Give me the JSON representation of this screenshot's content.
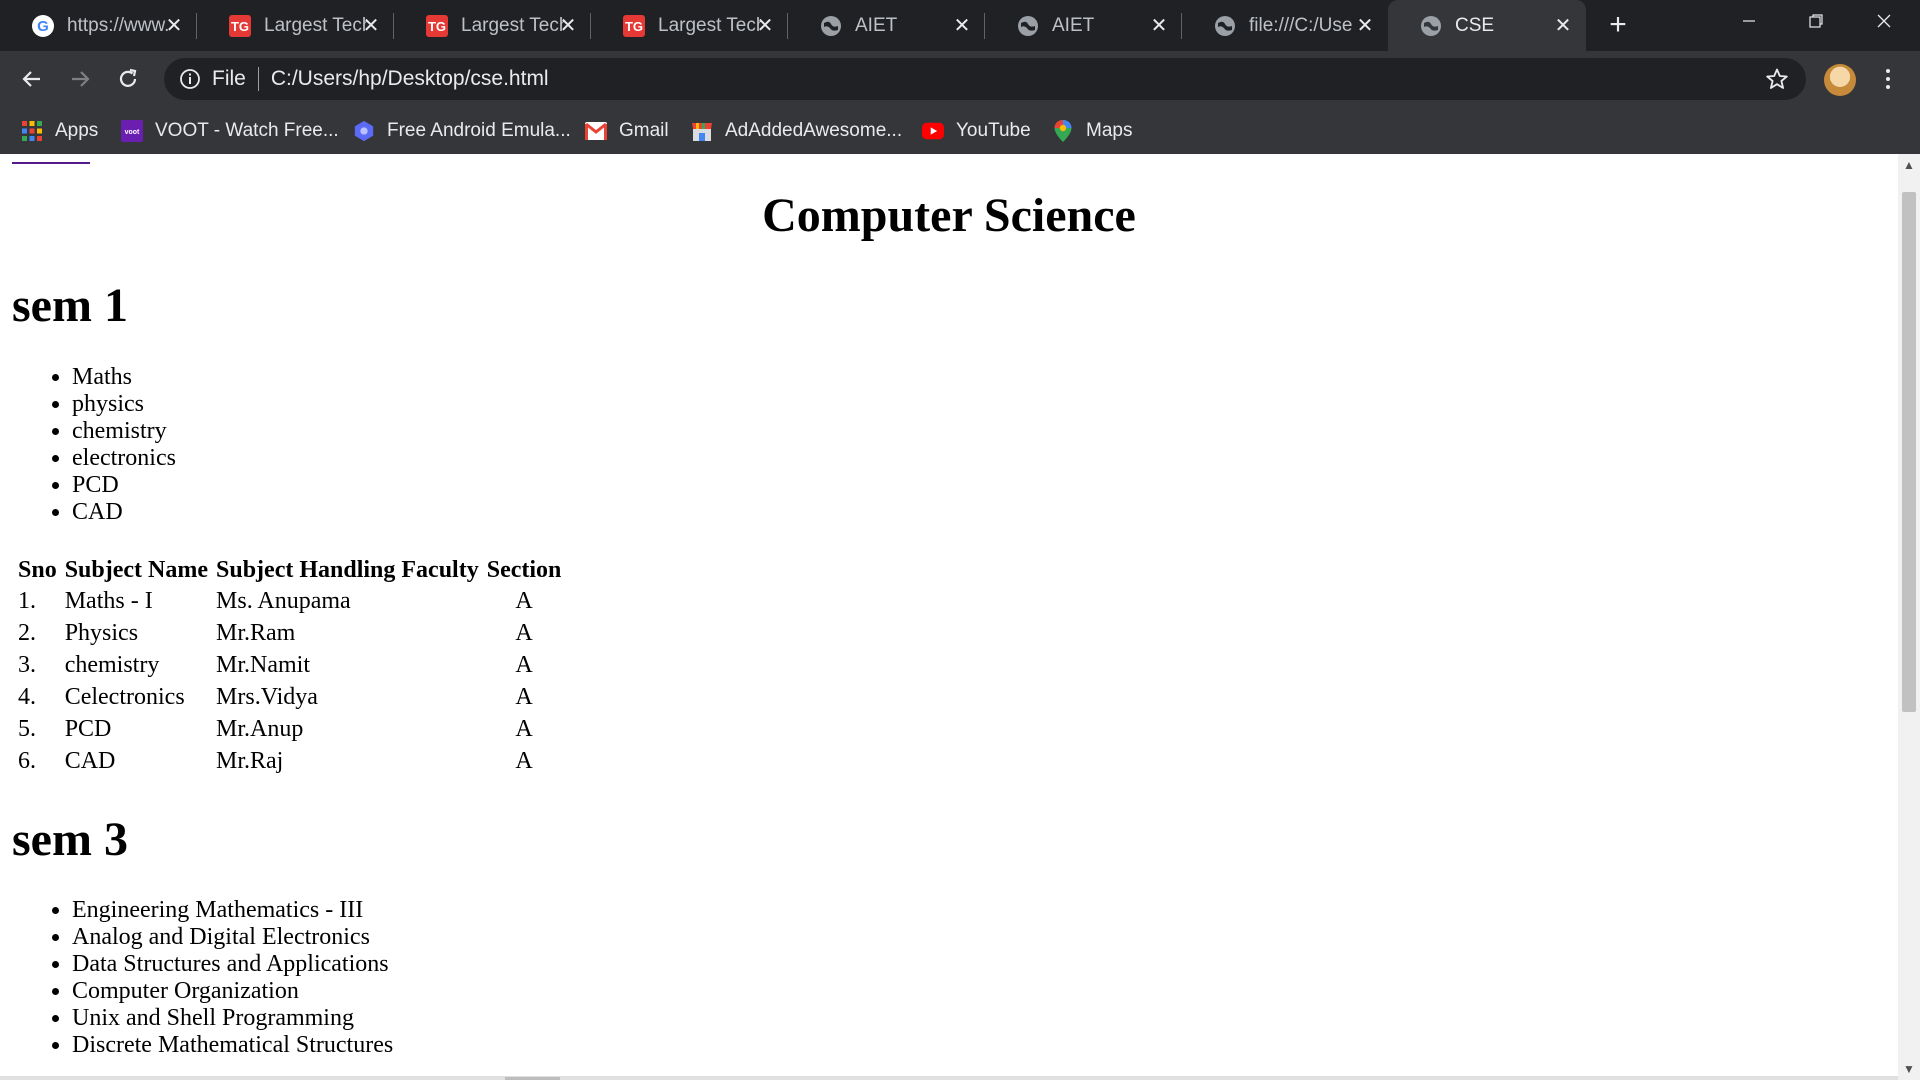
{
  "tabs": [
    {
      "title": "https://www.",
      "icon": "google-icon"
    },
    {
      "title": "Largest Tech",
      "icon": "tg-logo-icon"
    },
    {
      "title": "Largest Tech",
      "icon": "tg-logo-icon"
    },
    {
      "title": "Largest Tech",
      "icon": "tg-logo-icon"
    },
    {
      "title": "AIET",
      "icon": "globe-icon"
    },
    {
      "title": "AIET",
      "icon": "globe-icon"
    },
    {
      "title": "file:///C:/Use",
      "icon": "globe-icon"
    },
    {
      "title": "CSE",
      "icon": "globe-icon",
      "active": true
    }
  ],
  "toolbar": {
    "scheme_label": "File",
    "url": "C:/Users/hp/Desktop/cse.html"
  },
  "bookmarks": [
    {
      "label": "Apps",
      "icon": "apps-grid-icon"
    },
    {
      "label": "VOOT - Watch Free...",
      "icon": "voot-icon"
    },
    {
      "label": "Free Android Emula...",
      "icon": "emulator-icon"
    },
    {
      "label": "Gmail",
      "icon": "gmail-icon"
    },
    {
      "label": "AdAddedAwesome...",
      "icon": "store-icon"
    },
    {
      "label": "YouTube",
      "icon": "youtube-icon"
    },
    {
      "label": "Maps",
      "icon": "maps-icon"
    }
  ],
  "page": {
    "title": "Computer Science",
    "sem1": {
      "heading": "sem 1",
      "subjects": [
        "Maths",
        "physics",
        "chemistry",
        "electronics",
        "PCD",
        "CAD"
      ],
      "table": {
        "headers": [
          "Sno",
          "Subject Name",
          "Subject Handling Faculty",
          "Section"
        ],
        "rows": [
          [
            "1.",
            "Maths - I",
            "Ms. Anupama",
            "A"
          ],
          [
            "2.",
            "Physics",
            "Mr.Ram",
            "A"
          ],
          [
            "3.",
            "chemistry",
            "Mr.Namit",
            "A"
          ],
          [
            "4.",
            "Celectronics",
            "Mrs.Vidya",
            "A"
          ],
          [
            "5.",
            "PCD",
            "Mr.Anup",
            "A"
          ],
          [
            "6.",
            "CAD",
            "Mr.Raj",
            "A"
          ]
        ]
      }
    },
    "sem3": {
      "heading": "sem 3",
      "subjects": [
        "Engineering Mathematics - III",
        "Analog and Digital Electronics",
        "Data Structures and Applications",
        "Computer Organization",
        "Unix and Shell Programming",
        "Discrete Mathematical Structures"
      ]
    }
  }
}
